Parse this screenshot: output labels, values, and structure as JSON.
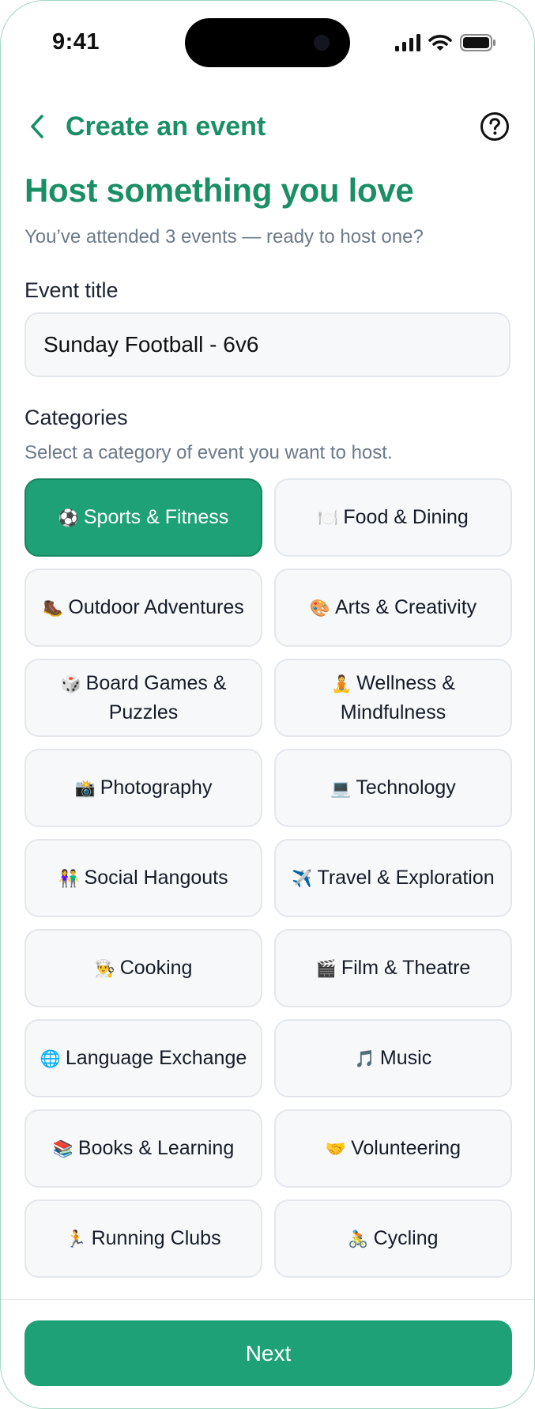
{
  "status_bar": {
    "time": "9:41"
  },
  "header": {
    "title": "Create an event",
    "back_icon": "chevron-left-icon",
    "help_icon": "question-circle-icon"
  },
  "hero": {
    "title": "Host something you love",
    "subtitle": "You’ve attended 3 events — ready to host one?"
  },
  "event_title": {
    "label": "Event title",
    "value": "Sunday Football - 6v6"
  },
  "categories": {
    "label": "Categories",
    "helper": "Select a category of event you want to host.",
    "selected": "Sports & Fitness",
    "items": [
      {
        "emoji": "⚽",
        "label": "Sports & Fitness"
      },
      {
        "emoji": "🍽️",
        "label": "Food & Dining"
      },
      {
        "emoji": "🥾",
        "label": "Outdoor Adventures"
      },
      {
        "emoji": "🎨",
        "label": "Arts & Creativity"
      },
      {
        "emoji": "🎲",
        "label": "Board Games & Puzzles"
      },
      {
        "emoji": "🧘",
        "label": "Wellness & Mindfulness"
      },
      {
        "emoji": "📸",
        "label": "Photography"
      },
      {
        "emoji": "💻",
        "label": "Technology"
      },
      {
        "emoji": "👫",
        "label": "Social Hangouts"
      },
      {
        "emoji": "✈️",
        "label": "Travel & Exploration"
      },
      {
        "emoji": "👨‍🍳",
        "label": "Cooking"
      },
      {
        "emoji": "🎬",
        "label": "Film & Theatre"
      },
      {
        "emoji": "🌐",
        "label": "Language Exchange"
      },
      {
        "emoji": "🎵",
        "label": "Music"
      },
      {
        "emoji": "📚",
        "label": "Books & Learning"
      },
      {
        "emoji": "🤝",
        "label": "Volunteering"
      },
      {
        "emoji": "🏃",
        "label": "Running Clubs"
      },
      {
        "emoji": "🚴",
        "label": "Cycling"
      }
    ]
  },
  "footer": {
    "next_label": "Next"
  },
  "colors": {
    "brand": "#1a8f66",
    "button": "#1ea176",
    "muted": "#6b7a8a",
    "border": "#e3e7ec"
  }
}
